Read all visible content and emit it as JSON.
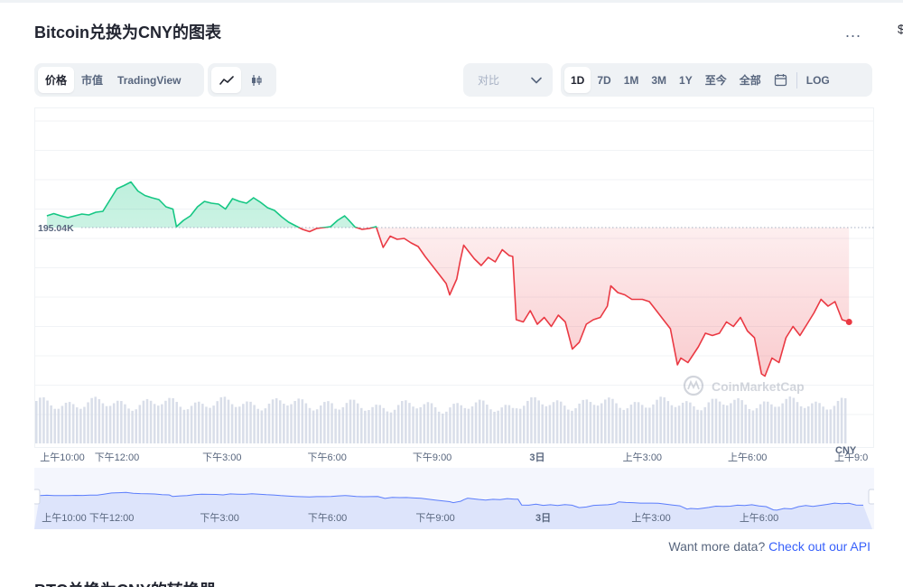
{
  "title": "Bitcoin兑换为CNY的图表",
  "more_label": "...",
  "edge_glyph": "$",
  "chart_type_tabs": [
    {
      "label": "价格",
      "active": true
    },
    {
      "label": "市值",
      "active": false
    },
    {
      "label": "TradingView",
      "active": false
    }
  ],
  "chart_style_icons": [
    {
      "name": "line-chart-icon",
      "active": true
    },
    {
      "name": "candlestick-icon",
      "active": false
    }
  ],
  "compare": {
    "label": "对比",
    "icon": "chevron-down-icon"
  },
  "range_tabs": [
    {
      "label": "1D",
      "active": true
    },
    {
      "label": "7D",
      "active": false
    },
    {
      "label": "1M",
      "active": false
    },
    {
      "label": "3M",
      "active": false
    },
    {
      "label": "1Y",
      "active": false
    },
    {
      "label": "至今",
      "active": false
    },
    {
      "label": "全部",
      "active": false
    }
  ],
  "calendar_icon": "calendar-icon",
  "log_label": "LOG",
  "colors": {
    "up": "#16c784",
    "down": "#ea3943",
    "volume": "#cfd6e4",
    "navigator_fill": "#dde4fb",
    "navigator_line": "#3861fb"
  },
  "chart_data": {
    "type": "line",
    "reference_value": 195.04,
    "reference_label": "195.04K",
    "currency_label": "CNY",
    "watermark": "CoinMarketCap",
    "x_ticks": [
      "上午10:00",
      "下午12:00",
      "下午3:00",
      "下午6:00",
      "下午9:00",
      "3日",
      "上午3:00",
      "上午6:00",
      "上午9:0"
    ],
    "x_tick_hours": [
      0,
      2,
      5,
      8,
      11,
      14,
      17,
      20,
      23
    ],
    "x_range_hours": [
      -0.1,
      23.1
    ],
    "y_range": [
      191.5,
      197.2
    ],
    "series": [
      {
        "values": [
          [
            0.0,
            195.3
          ],
          [
            0.2,
            195.35
          ],
          [
            0.4,
            195.3
          ],
          [
            0.6,
            195.26
          ],
          [
            0.8,
            195.3
          ],
          [
            1.0,
            195.34
          ],
          [
            1.2,
            195.32
          ],
          [
            1.4,
            195.38
          ],
          [
            1.6,
            195.4
          ],
          [
            1.8,
            195.65
          ],
          [
            2.0,
            195.9
          ],
          [
            2.2,
            195.97
          ],
          [
            2.4,
            196.05
          ],
          [
            2.6,
            195.85
          ],
          [
            2.8,
            195.75
          ],
          [
            3.0,
            195.7
          ],
          [
            3.2,
            195.66
          ],
          [
            3.4,
            195.5
          ],
          [
            3.6,
            195.45
          ],
          [
            3.7,
            195.06
          ],
          [
            3.9,
            195.2
          ],
          [
            4.1,
            195.3
          ],
          [
            4.3,
            195.5
          ],
          [
            4.5,
            195.62
          ],
          [
            4.7,
            195.58
          ],
          [
            4.9,
            195.56
          ],
          [
            5.1,
            195.45
          ],
          [
            5.3,
            195.68
          ],
          [
            5.5,
            195.62
          ],
          [
            5.7,
            195.58
          ],
          [
            5.9,
            195.7
          ],
          [
            6.1,
            195.6
          ],
          [
            6.3,
            195.48
          ],
          [
            6.5,
            195.42
          ],
          [
            6.7,
            195.28
          ],
          [
            6.9,
            195.16
          ],
          [
            7.1,
            195.08
          ],
          [
            7.3,
            195.0
          ],
          [
            7.5,
            194.95
          ],
          [
            7.7,
            195.02
          ],
          [
            7.9,
            195.04
          ],
          [
            8.1,
            195.06
          ],
          [
            8.3,
            195.2
          ],
          [
            8.5,
            195.3
          ],
          [
            8.6,
            195.22
          ],
          [
            8.8,
            195.05
          ],
          [
            9.0,
            195.0
          ],
          [
            9.2,
            195.02
          ],
          [
            9.4,
            195.06
          ],
          [
            9.6,
            194.6
          ],
          [
            9.8,
            194.85
          ],
          [
            10.0,
            194.78
          ],
          [
            10.2,
            194.8
          ],
          [
            10.4,
            194.7
          ],
          [
            10.6,
            194.62
          ],
          [
            10.8,
            194.4
          ],
          [
            11.0,
            194.2
          ],
          [
            11.2,
            194.0
          ],
          [
            11.4,
            193.8
          ],
          [
            11.5,
            193.55
          ],
          [
            11.7,
            193.9
          ],
          [
            11.8,
            194.3
          ],
          [
            11.9,
            194.65
          ],
          [
            12.0,
            194.55
          ],
          [
            12.2,
            194.35
          ],
          [
            12.4,
            194.2
          ],
          [
            12.6,
            194.38
          ],
          [
            12.8,
            194.28
          ],
          [
            13.0,
            194.55
          ],
          [
            13.2,
            194.42
          ],
          [
            13.3,
            194.4
          ],
          [
            13.4,
            193.0
          ],
          [
            13.6,
            192.95
          ],
          [
            13.8,
            193.2
          ],
          [
            14.0,
            192.9
          ],
          [
            14.2,
            193.05
          ],
          [
            14.4,
            192.85
          ],
          [
            14.6,
            193.1
          ],
          [
            14.8,
            192.95
          ],
          [
            15.0,
            192.35
          ],
          [
            15.2,
            192.5
          ],
          [
            15.4,
            192.9
          ],
          [
            15.6,
            193.0
          ],
          [
            15.8,
            193.05
          ],
          [
            16.0,
            193.3
          ],
          [
            16.1,
            193.75
          ],
          [
            16.3,
            193.6
          ],
          [
            16.5,
            193.55
          ],
          [
            16.7,
            193.45
          ],
          [
            17.0,
            193.45
          ],
          [
            17.2,
            193.4
          ],
          [
            17.4,
            193.2
          ],
          [
            17.6,
            193.0
          ],
          [
            17.8,
            192.8
          ],
          [
            18.0,
            192.0
          ],
          [
            18.1,
            192.15
          ],
          [
            18.3,
            192.05
          ],
          [
            18.6,
            192.4
          ],
          [
            18.8,
            192.7
          ],
          [
            19.0,
            192.65
          ],
          [
            19.2,
            192.7
          ],
          [
            19.4,
            192.95
          ],
          [
            19.6,
            192.85
          ],
          [
            19.8,
            193.05
          ],
          [
            20.0,
            192.75
          ],
          [
            20.2,
            192.6
          ],
          [
            20.4,
            191.8
          ],
          [
            20.5,
            191.75
          ],
          [
            20.7,
            192.15
          ],
          [
            20.9,
            192.05
          ],
          [
            21.1,
            192.6
          ],
          [
            21.3,
            192.85
          ],
          [
            21.5,
            192.65
          ],
          [
            21.7,
            192.9
          ],
          [
            21.9,
            193.15
          ],
          [
            22.1,
            193.45
          ],
          [
            22.3,
            193.3
          ],
          [
            22.5,
            193.4
          ],
          [
            22.7,
            193.0
          ],
          [
            22.9,
            192.95
          ]
        ]
      }
    ],
    "navigator_ticks": [
      "上午10:00",
      "下午12:00",
      "下午3:00",
      "下午6:00",
      "下午9:00",
      "3日",
      "上午3:00",
      "上午6:00"
    ],
    "navigator_tick_hours": [
      0,
      2,
      5,
      8,
      11,
      14,
      17,
      20
    ]
  },
  "footer_text": "Want more data? ",
  "footer_link": "Check out our API",
  "next_section_title": "BTC兑换为CNY的转换器"
}
